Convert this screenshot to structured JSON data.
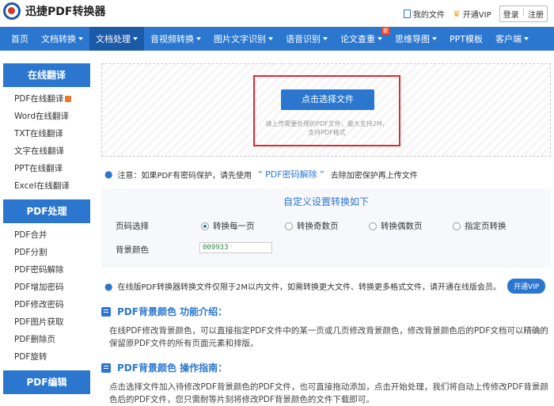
{
  "header": {
    "logo_text": "迅捷PDF转换器",
    "my_files": "我的文件",
    "vip": "开通VIP",
    "login": "登录",
    "separator": "|",
    "register": "注册"
  },
  "nav": {
    "items": [
      {
        "label": "首页",
        "caret": false
      },
      {
        "label": "文档转换",
        "caret": true
      },
      {
        "label": "文档处理",
        "caret": true,
        "active": true
      },
      {
        "label": "音视频转换",
        "caret": true
      },
      {
        "label": "图片文字识别",
        "caret": true
      },
      {
        "label": "语音识别",
        "caret": true
      },
      {
        "label": "论文查重",
        "caret": true,
        "badge": "新"
      },
      {
        "label": "思维导图",
        "caret": true
      },
      {
        "label": "PPT模板",
        "caret": false
      },
      {
        "label": "客户端",
        "caret": true
      }
    ]
  },
  "sidebar": {
    "groups": [
      {
        "title": "在线翻译",
        "items": [
          "PDF在线翻译",
          "Word在线翻译",
          "TXT在线翻译",
          "文字在线翻译",
          "PPT在线翻译",
          "Excel在线翻译"
        ]
      },
      {
        "title": "PDF处理",
        "items": [
          "PDF合并",
          "PDF分割",
          "PDF密码解除",
          "PDF增加密码",
          "PDF修改密码",
          "PDF图片获取",
          "PDF删除页",
          "PDF旋转"
        ]
      },
      {
        "title": "PDF编辑",
        "items": []
      }
    ]
  },
  "upload": {
    "button": "点击选择文件",
    "hint_line1": "请上传需要处理的PDF文件，最大支持2M，",
    "hint_line2": "支持PDF格式"
  },
  "notice": {
    "prefix": "注意：如果PDF有密码保护，请先使用",
    "link": "“ PDF密码解除 ”",
    "suffix": "去除加密保护再上传文件"
  },
  "settings": {
    "title": "自定义设置转换如下",
    "page_label": "页码选择",
    "options": [
      "转换每一页",
      "转换奇数页",
      "转换偶数页",
      "指定页转换"
    ],
    "selected": 0,
    "bg_label": "背景颜色",
    "bg_value": "009933"
  },
  "vip_notice": {
    "text": "在线版PDF转换器转换文件仅限于2M以内文件，如需转换更大文件、转换更多格式文件，请开通在线版会员。",
    "button": "开通VIP"
  },
  "intro": {
    "title": "PDF背景颜色 功能介绍：",
    "text": "在线PDF修改背景颜色，可以直接指定PDF文件中的某一页或几页修改背景颜色，修改背景颜色后的PDF文档可以精确的保留原PDF文件的所有页面元素和排版。"
  },
  "guide": {
    "title": "PDF背景颜色 操作指南：",
    "text": "点击选择文件加入待修改PDF背景颜色的PDF文件，也可直接拖动添加，点击开始处理，我们将自动上传修改PDF背景颜色后的PDF文件，您只需耐等片刻将修改PDF背景颜色的文件下载即可。"
  }
}
